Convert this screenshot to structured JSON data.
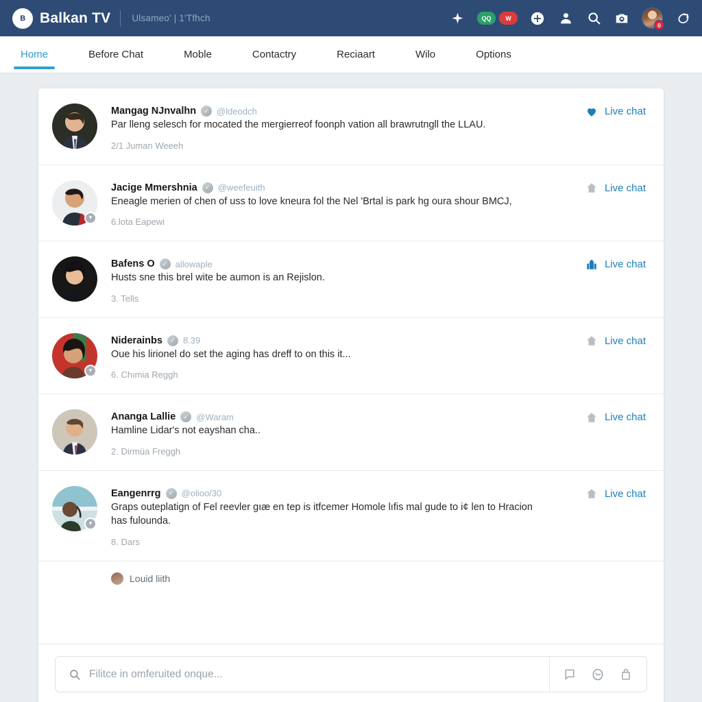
{
  "header": {
    "logo_mark": "B",
    "brand": "Balkan TV",
    "subtitle": "Ulsameo' | 1'Tfhch",
    "icons": [
      {
        "name": "sparkle-icon",
        "glyph": "sparkle"
      },
      {
        "name": "status-pill-green",
        "glyph": "pill",
        "label": "QQ",
        "color": "#2aa06a"
      },
      {
        "name": "status-pill-red",
        "glyph": "pill",
        "label": "W",
        "color": "#dc3b3b"
      },
      {
        "name": "add-circle-icon",
        "glyph": "plus-circle"
      },
      {
        "name": "person-icon",
        "glyph": "person"
      },
      {
        "name": "search-icon",
        "glyph": "search"
      },
      {
        "name": "camera-icon",
        "glyph": "camera"
      },
      {
        "name": "user-avatar",
        "glyph": "avatar",
        "badge": "0"
      },
      {
        "name": "refresh-leaf-icon",
        "glyph": "refresh"
      }
    ]
  },
  "tabs": [
    {
      "label": "Home",
      "active": true
    },
    {
      "label": "Before Chat",
      "active": false
    },
    {
      "label": "Moble",
      "active": false
    },
    {
      "label": "Contactry",
      "active": false
    },
    {
      "label": "Reciaart",
      "active": false
    },
    {
      "label": "Wilo",
      "active": false
    },
    {
      "label": "Options",
      "active": false
    }
  ],
  "feed": {
    "action_label": "Live chat",
    "items": [
      {
        "name": "Mangag NJnvalhn",
        "handle": "@ldeodch",
        "text": "Par lleng selesch for mocated the mergierreof foonph vation all brawrutngll the LLAU.",
        "meta": "2/1 Juman Weeeh",
        "action_icon": "heart-icon",
        "action_icon_color": "blue",
        "avatar_badge": false
      },
      {
        "name": "Jacige Mmershnia",
        "handle": "@weefeuith",
        "text": "Eneagle merien of chen of uss to love kneura fol the Nel 'Brtal is park hg oura shour BMCJ,",
        "meta": "6.lota Eapewi",
        "action_icon": "home-icon",
        "action_icon_color": "gray",
        "avatar_badge": true
      },
      {
        "name": "Bafens O",
        "handle": "allowaple",
        "text": "Husts sne this brel wite be aumon is an Rejislon.",
        "meta": "3. Tells",
        "action_icon": "building-icon",
        "action_icon_color": "blue",
        "avatar_badge": false
      },
      {
        "name": "Niderainbs",
        "handle": "8.39",
        "text": "Oue his lirionel do set the aging has dreff to on this it...",
        "meta": "6. Chımia Reggh",
        "action_icon": "home-icon",
        "action_icon_color": "gray",
        "avatar_badge": true
      },
      {
        "name": "Ananga Lallie",
        "handle": "@Waram",
        "text": "Hamline Lidar's not eayshan cha..",
        "meta": "2. Dirmüa Freggh",
        "action_icon": "home-icon",
        "action_icon_color": "gray",
        "avatar_badge": false
      },
      {
        "name": "Eangenrrg",
        "handle": "@olioo/30",
        "text": "Graps outeplatign of Fel reevler gıæ en tep is itfcemer Homole lıfis mal gude to i¢ len to Hracion has fulounda.",
        "meta": "8. Dars",
        "action_icon": "home-icon",
        "action_icon_color": "gray",
        "avatar_badge": true
      }
    ],
    "footnote": "Louid liith"
  },
  "composer": {
    "placeholder": "Filitce in omferuited onque...",
    "value": "",
    "tools": [
      {
        "name": "comment-icon"
      },
      {
        "name": "emoji-icon"
      },
      {
        "name": "bag-icon"
      }
    ]
  },
  "colors": {
    "header_bg": "#2d4b75",
    "page_bg": "#e9edf0",
    "accent": "#2e9fd4",
    "link": "#1b7fb8",
    "badge_red": "#e0243c",
    "pill_green": "#2aa06a",
    "pill_red": "#dc3b3b"
  }
}
